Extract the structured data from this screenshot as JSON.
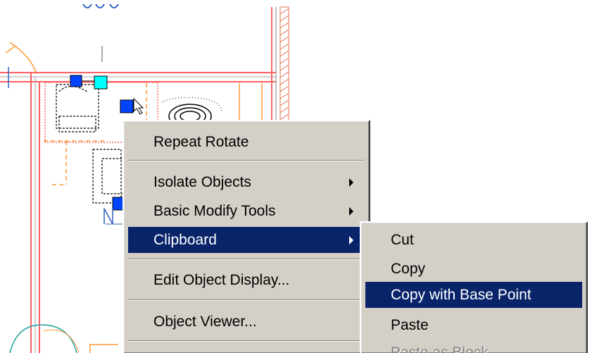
{
  "context_menu": {
    "items": [
      {
        "label": "Repeat Rotate"
      },
      {
        "label": "Isolate Objects"
      },
      {
        "label": "Basic Modify Tools"
      },
      {
        "label": "Clipboard"
      },
      {
        "label": "Edit Object Display..."
      },
      {
        "label": "Object Viewer..."
      }
    ],
    "highlighted": "Clipboard"
  },
  "clipboard_submenu": {
    "items": [
      {
        "label": "Cut"
      },
      {
        "label": "Copy"
      },
      {
        "label": "Copy with Base Point"
      },
      {
        "label": "Paste"
      },
      {
        "label": "Paste as Block"
      }
    ],
    "highlighted": "Copy with Base Point",
    "disabled": [
      "Paste as Block"
    ]
  },
  "colors": {
    "menu_bg": "#d4d0c8",
    "highlight_bg": "#0a246a",
    "highlight_text": "#ffffff",
    "wall_red": "#ff6060",
    "wall_hatch": "#e07050",
    "dim_orange": "#ff9933",
    "grip_blue": "#0044ff",
    "grip_cyan": "#00ffff",
    "text_blue": "#3060c0",
    "teal": "#20a0a0"
  }
}
